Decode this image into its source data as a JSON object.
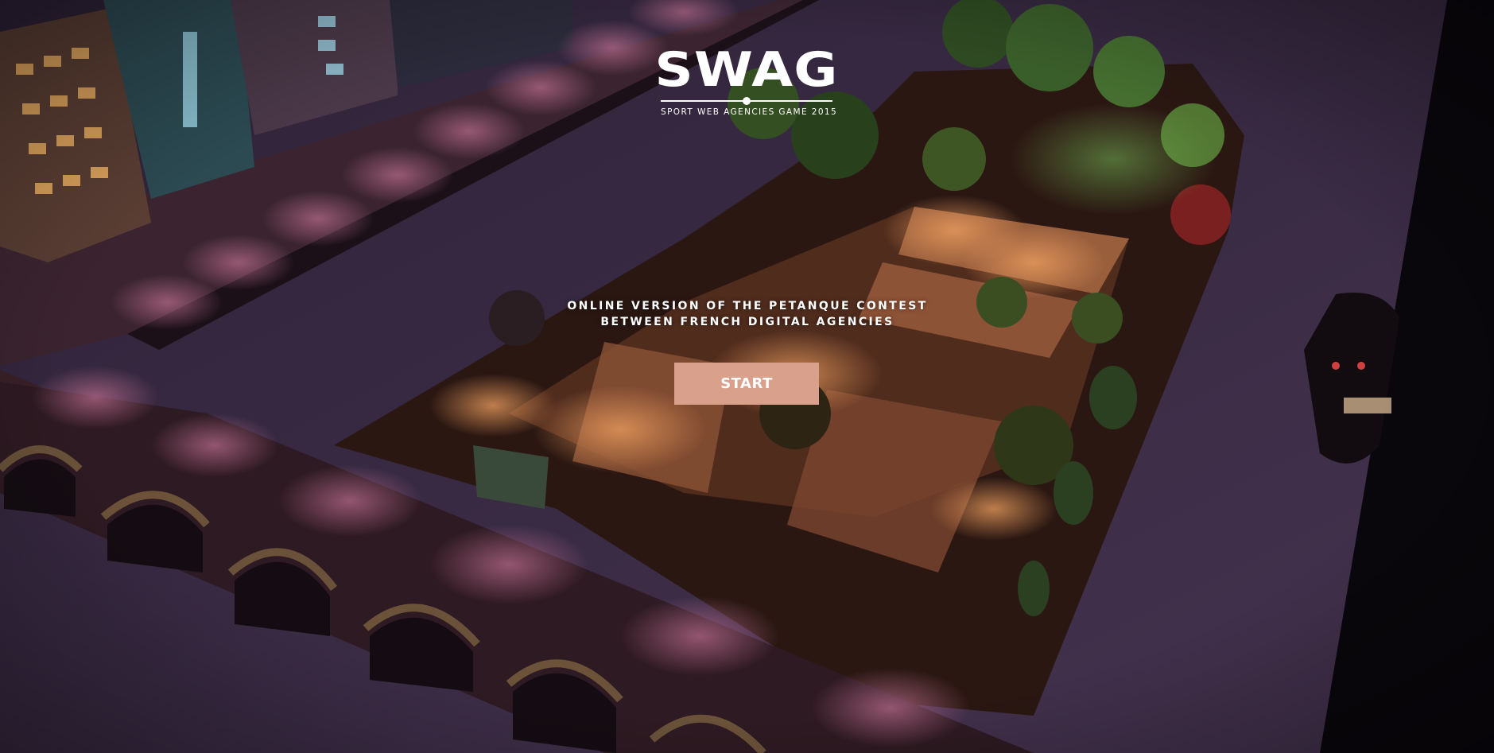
{
  "logo": {
    "word": "SWAG",
    "subtitle": "SPORT WEB AGENCIES GAME 2015"
  },
  "tagline": {
    "line1": "ONLINE VERSION OF THE PETANQUE CONTEST",
    "line2": "BETWEEN FRENCH DIGITAL AGENCIES"
  },
  "start_button": {
    "label": "START"
  },
  "colors": {
    "button": "#d9a18c",
    "water": "#3a2a45",
    "background": "#1c1424",
    "text": "#ffffff"
  },
  "icons": {
    "logo_mark": "swag-logo"
  }
}
